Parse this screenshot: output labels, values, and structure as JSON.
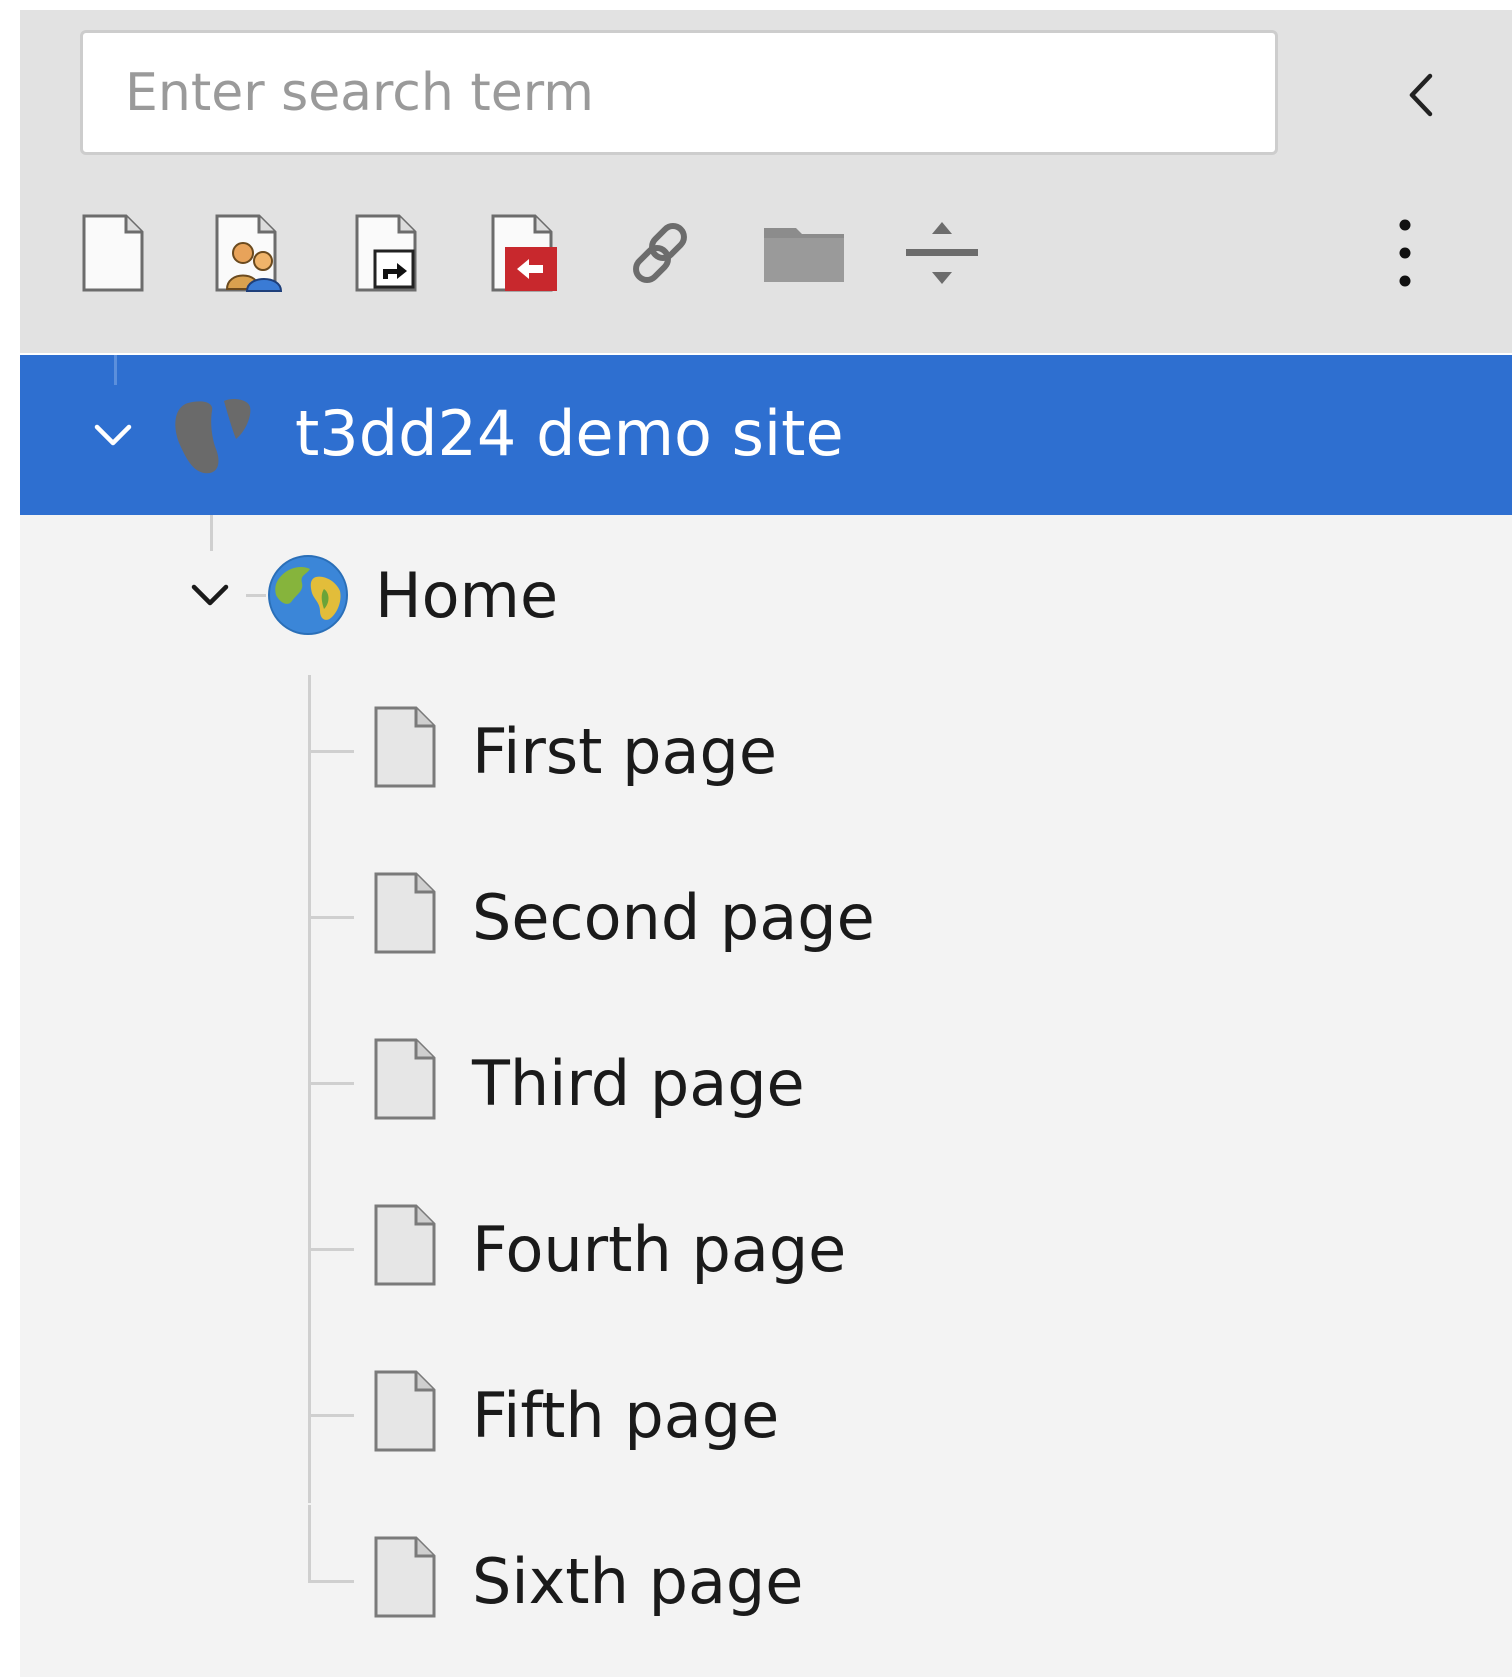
{
  "search": {
    "placeholder": "Enter search term",
    "value": ""
  },
  "toolbar": {
    "collapse_icon": "chevron-left-icon",
    "tools": [
      {
        "name": "new-page-icon"
      },
      {
        "name": "backend-user-section-icon"
      },
      {
        "name": "shortcut-page-icon"
      },
      {
        "name": "mountpoint-page-icon"
      },
      {
        "name": "link-external-icon"
      },
      {
        "name": "folder-icon"
      },
      {
        "name": "spacer-icon"
      }
    ],
    "more_icon": "more-options-icon"
  },
  "tree": {
    "root": {
      "label": "t3dd24 demo site",
      "icon": "typo3-site-icon",
      "expanded": true,
      "selected": true
    },
    "home": {
      "label": "Home",
      "icon": "globe-icon",
      "expanded": true
    },
    "pages": [
      {
        "label": "First page"
      },
      {
        "label": "Second page"
      },
      {
        "label": "Third page"
      },
      {
        "label": "Fourth page"
      },
      {
        "label": "Fifth page"
      },
      {
        "label": "Sixth page"
      }
    ]
  },
  "colors": {
    "selected_row": "#2e6fd0",
    "toolbar_bg": "#e2e2e2",
    "tree_bg": "#f3f3f3",
    "mountpoint_red": "#c8282d"
  }
}
